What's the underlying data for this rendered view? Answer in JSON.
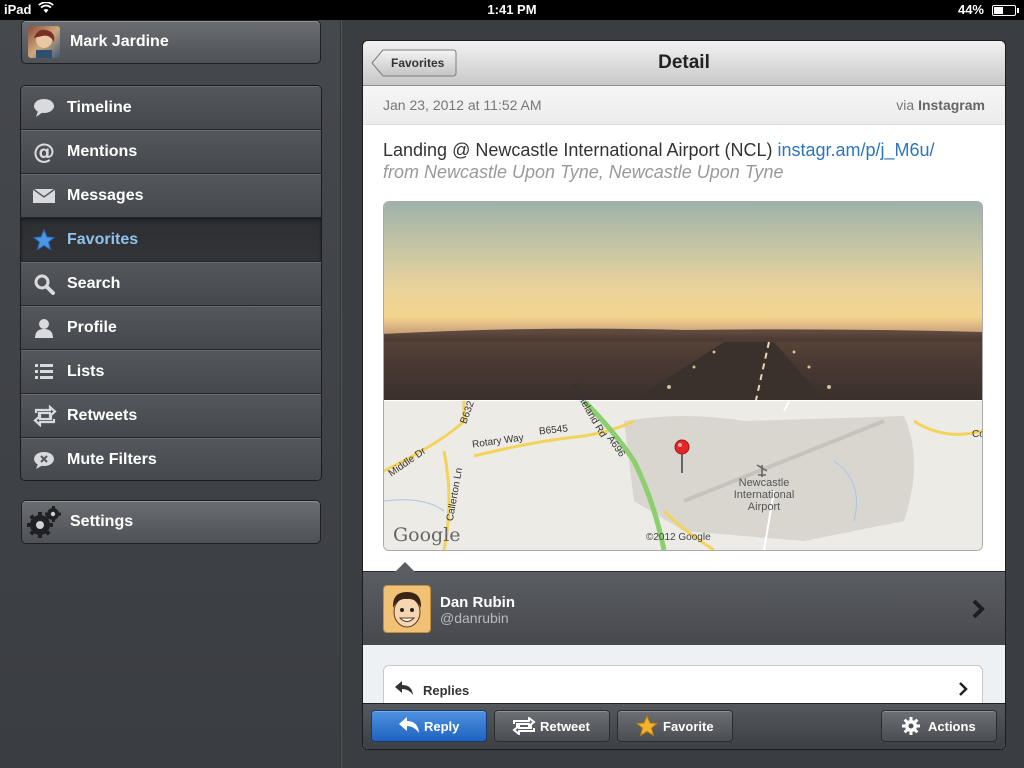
{
  "status_bar": {
    "device": "iPad",
    "time": "1:41 PM",
    "battery": "44%"
  },
  "sidebar": {
    "account_name": "Mark Jardine",
    "items": [
      {
        "label": "Timeline",
        "icon": "speech-bubble-icon"
      },
      {
        "label": "Mentions",
        "icon": "at-sign-icon"
      },
      {
        "label": "Messages",
        "icon": "envelope-icon"
      },
      {
        "label": "Favorites",
        "icon": "star-icon",
        "active": true
      },
      {
        "label": "Search",
        "icon": "magnifier-icon"
      },
      {
        "label": "Profile",
        "icon": "person-icon"
      },
      {
        "label": "Lists",
        "icon": "list-icon"
      },
      {
        "label": "Retweets",
        "icon": "retweet-icon"
      },
      {
        "label": "Mute Filters",
        "icon": "mute-icon"
      }
    ],
    "settings_label": "Settings"
  },
  "detail": {
    "back_label": "Favorites",
    "title": "Detail",
    "timestamp": "Jan 23, 2012 at 11:52 AM",
    "via_prefix": "via",
    "via_source": "Instagram",
    "tweet_text": "Landing  @ Newcastle International Airport (NCL)",
    "tweet_link": "instagr.am/p/j_M6u/",
    "tweet_place": "from Newcastle Upon Tyne, Newcastle Upon Tyne",
    "map": {
      "provider": "Google",
      "copyright": "©2012 Google",
      "airport_label": [
        "Newcastle",
        "International",
        "Airport"
      ],
      "road_labels": [
        "Rotary Way",
        "B6545",
        "Middle Dr",
        "Callerton Ln",
        "A696",
        "B632",
        "Ponteland Rd",
        "Co"
      ]
    },
    "author": {
      "name": "Dan Rubin",
      "handle": "@danrubin"
    },
    "replies_label": "Replies"
  },
  "toolbar": {
    "reply_label": "Reply",
    "retweet_label": "Retweet",
    "favorite_label": "Favorite",
    "actions_label": "Actions"
  },
  "colors": {
    "accent_blue": "#2d76b9",
    "active_menu_text": "#8ec3f0",
    "reply_button": "#1f63c0"
  }
}
